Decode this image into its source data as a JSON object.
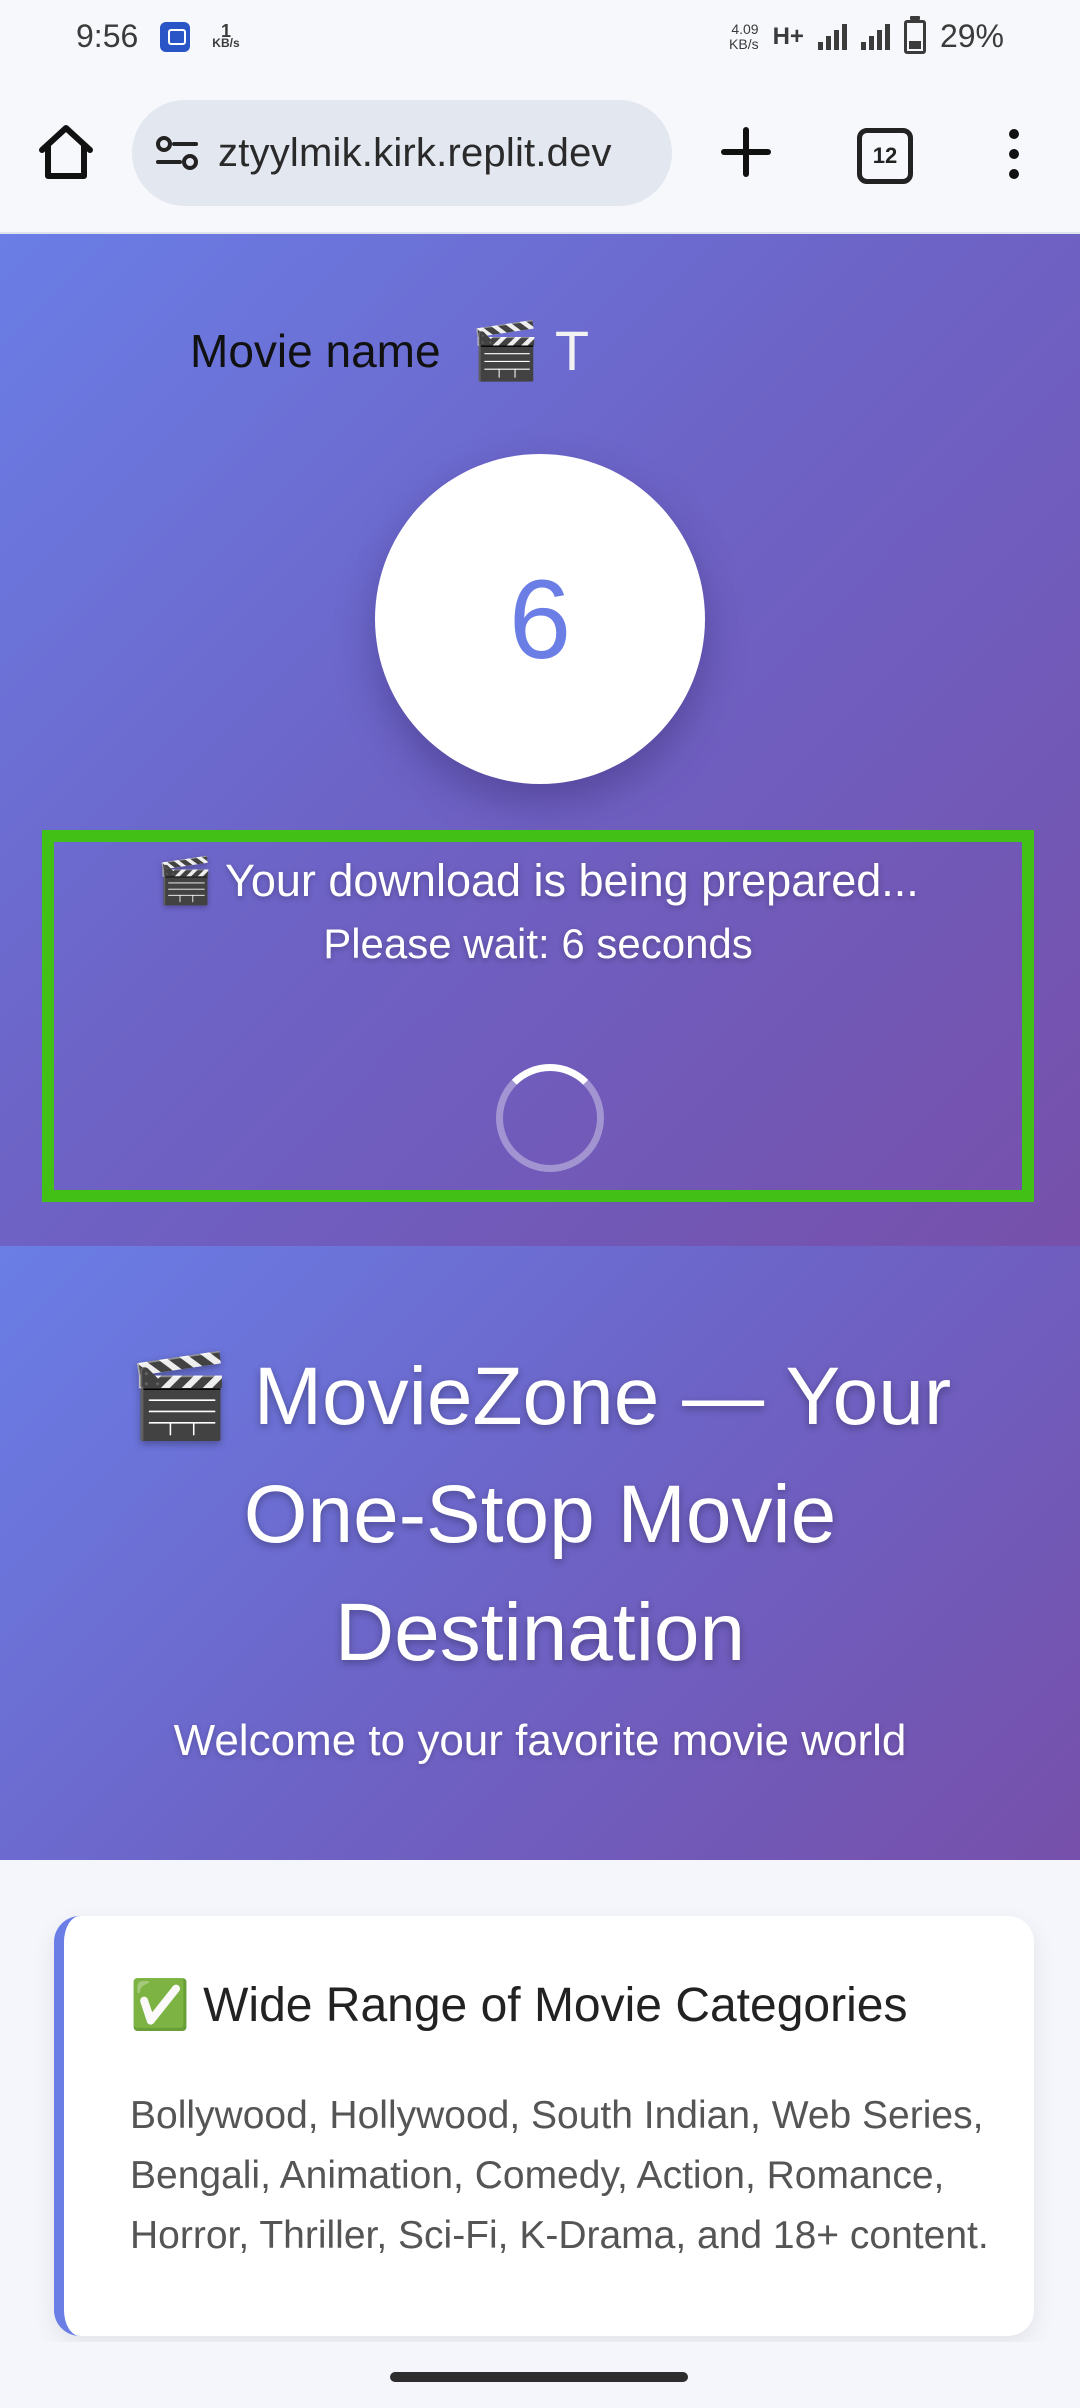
{
  "status_bar": {
    "time": "9:56",
    "data_rate_value": "1",
    "data_rate_unit": "KB/s",
    "net_speed_value": "4.09",
    "net_speed_unit": "KB/s",
    "network_type": "H+",
    "battery_percent": "29%"
  },
  "browser": {
    "url": "ztyylmik.kirk.replit.dev",
    "tab_count": "12"
  },
  "loader": {
    "movie_label": "Movie name",
    "movie_value": "🎬 T",
    "countdown": "6",
    "preparing_text": "🎬 Your download is being prepared...",
    "wait_text": "Please wait: 6 seconds"
  },
  "hero": {
    "title": "🎬 MovieZone — Your One-Stop Movie Destination",
    "subtitle": "Welcome to your favorite movie world"
  },
  "features": [
    {
      "title": "✅ Wide Range of Movie Categories",
      "text": "Bollywood, Hollywood, South Indian, Web Series, Bengali, Animation, Comedy, Action, Romance, Horror, Thriller, Sci-Fi, K-Drama, and 18+ content."
    }
  ],
  "colors": {
    "accent": "#6a7ee6",
    "gradient_end": "#7650aa",
    "highlight_box": "#43c015"
  },
  "icons": [
    "home-icon",
    "site-settings-icon",
    "plus-icon",
    "tabs-icon",
    "more-vert-icon"
  ]
}
